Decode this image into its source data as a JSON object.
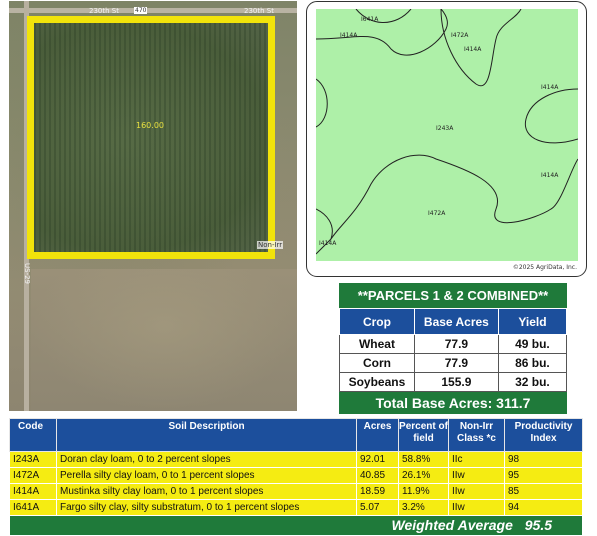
{
  "aerial": {
    "field_acres": "160.00",
    "road_labels": [
      "230th St",
      "230th St",
      "Non-Irr",
      "US-29",
      "470"
    ]
  },
  "soil_map": {
    "labels": [
      "I641A",
      "I414A",
      "I472A",
      "I414A",
      "I414A",
      "I243A",
      "I414A",
      "I472A",
      "I414A"
    ],
    "copyright": "©2025 AgriData, Inc.",
    "fill_color": "#aef0a8",
    "line_color": "#222222"
  },
  "parcels": {
    "title": "**PARCELS 1 & 2 COMBINED**",
    "headers": [
      "Crop",
      "Base Acres",
      "Yield"
    ],
    "rows": [
      [
        "Wheat",
        "77.9",
        "49 bu."
      ],
      [
        "Corn",
        "77.9",
        "86 bu."
      ],
      [
        "Soybeans",
        "155.9",
        "32 bu."
      ]
    ],
    "total_label": "Total Base Acres:",
    "total_value": "311.7",
    "header_color": "#1c4f9c",
    "title_color": "#1f7a3a"
  },
  "soil_table": {
    "headers": [
      "Code",
      "Soil Description",
      "Acres",
      "Percent of field",
      "Non-Irr Class *c",
      "Productivity Index"
    ],
    "rows": [
      [
        "I243A",
        "Doran clay loam, 0 to 2 percent slopes",
        "92.01",
        "58.8%",
        "IIc",
        "98"
      ],
      [
        "I472A",
        "Perella silty clay loam, 0 to 1 percent slopes",
        "40.85",
        "26.1%",
        "IIw",
        "95"
      ],
      [
        "I414A",
        "Mustinka silty clay loam, 0 to 1 percent slopes",
        "18.59",
        "11.9%",
        "IIw",
        "85"
      ],
      [
        "I641A",
        "Fargo silty clay, silty substratum, 0 to 1 percent slopes",
        "5.07",
        "3.2%",
        "IIw",
        "94"
      ]
    ],
    "weighted_label": "Weighted Average",
    "weighted_value": "95.5",
    "row_color": "#f5ec12"
  }
}
